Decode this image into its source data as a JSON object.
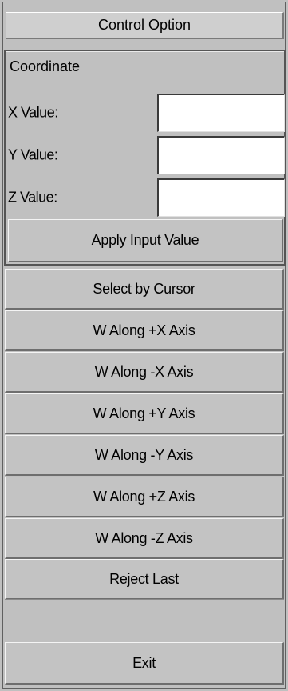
{
  "title": "Control Option",
  "coordinate_group": {
    "label": "Coordinate",
    "fields": [
      {
        "label": "X Value:",
        "value": ""
      },
      {
        "label": "Y Value:",
        "value": ""
      },
      {
        "label": "Z Value:",
        "value": ""
      }
    ],
    "apply_label": "Apply Input Value"
  },
  "buttons": {
    "select_by_cursor": "Select by Cursor",
    "w_plus_x": "W Along +X Axis",
    "w_minus_x": "W Along -X Axis",
    "w_plus_y": "W Along +Y Axis",
    "w_minus_y": "W Along -Y Axis",
    "w_plus_z": "W Along +Z Axis",
    "w_minus_z": "W Along -Z Axis",
    "reject_last": "Reject Last",
    "exit": "Exit"
  }
}
